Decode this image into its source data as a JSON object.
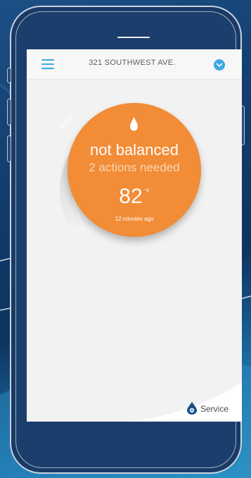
{
  "header": {
    "address": "321 SOUTHWEST AVE."
  },
  "status": {
    "body_label": "Pool",
    "title": "not balanced",
    "subtitle": "2 actions needed",
    "temperature": "82",
    "temperature_unit": "°F",
    "updated": "12 minutes ago"
  },
  "footer": {
    "service_label": "Service"
  },
  "colors": {
    "accent": "#3ea7e3",
    "status": "#f28c36",
    "background": "#f2f2f2"
  },
  "icons": {
    "menu": "hamburger-icon",
    "dropdown": "chevron-down-icon",
    "status": "water-drop-icon",
    "service": "service-drop-icon"
  }
}
